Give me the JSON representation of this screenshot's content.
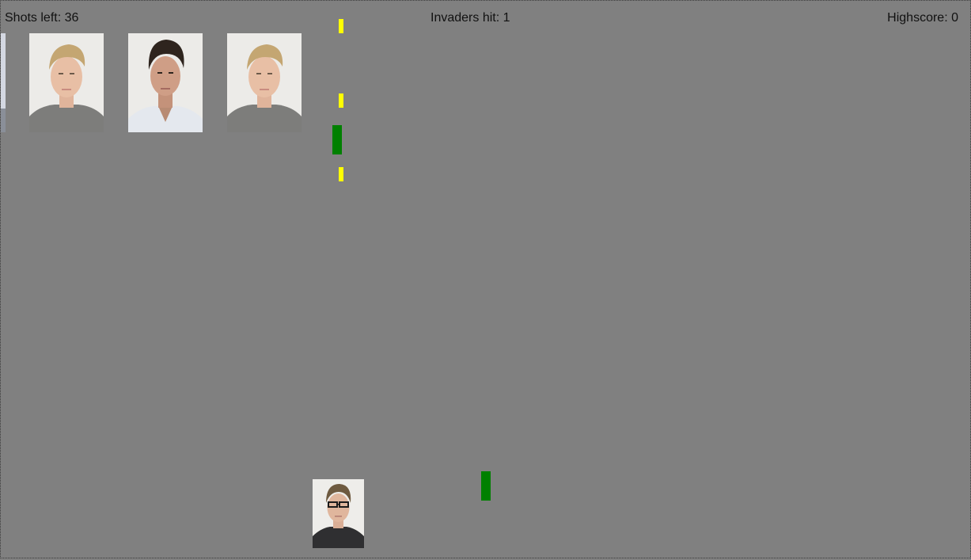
{
  "hud": {
    "shots_left": "Shots left: 36",
    "invaders_hit": "Invaders hit: 1",
    "highscore": "Highscore: 0"
  },
  "colors": {
    "background": "#808080",
    "player_shot": "#ffff00",
    "invader_shot": "#008000"
  },
  "invaders": [
    {
      "face": "blond-man-portrait",
      "visible": "partial"
    },
    {
      "face": "blond-man-portrait"
    },
    {
      "face": "dark-haired-man-portrait"
    },
    {
      "face": "blond-man-portrait"
    }
  ],
  "player": {
    "face": "man-with-glasses-portrait"
  },
  "projectiles": {
    "player_shots": 3,
    "invader_shots": 2
  }
}
